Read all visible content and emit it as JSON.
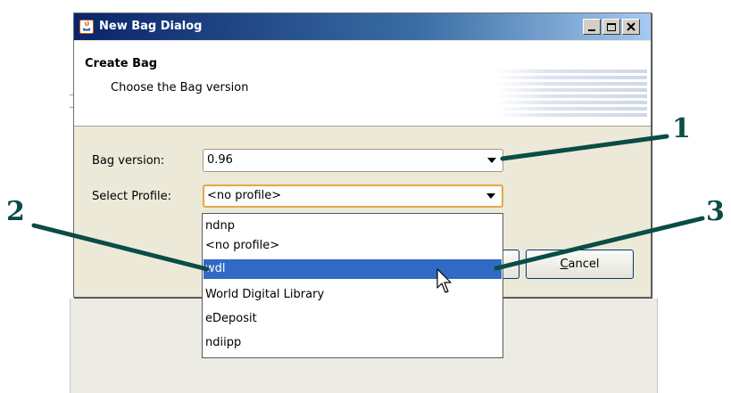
{
  "dialog": {
    "title": "New Bag Dialog",
    "header_title": "Create Bag",
    "header_subtitle": "Choose the Bag version"
  },
  "form": {
    "version_label": "Bag version:",
    "version_value": "0.96",
    "profile_label": "Select Profile:",
    "profile_value": "<no profile>"
  },
  "buttons": {
    "cancel": "Cancel"
  },
  "dropdown": {
    "options": [
      "ndnp",
      "<no profile>",
      "wdl",
      "World Digital Library",
      "eDeposit",
      "ndiipp"
    ],
    "selected_option": "wdl"
  },
  "callouts": [
    "1",
    "2",
    "3"
  ],
  "colors": {
    "titlebar_start": "#0a246a",
    "titlebar_end": "#a6caf0",
    "selection": "#316ac5",
    "callout": "#0b4c46",
    "focus_border": "#e3a948"
  }
}
